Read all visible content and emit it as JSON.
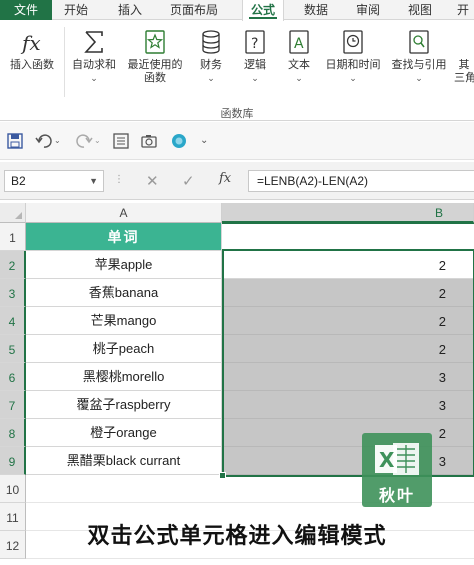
{
  "tabs": [
    {
      "label": "文件"
    },
    {
      "label": "开始"
    },
    {
      "label": "插入"
    },
    {
      "label": "页面布局"
    },
    {
      "label": "公式"
    },
    {
      "label": "数据"
    },
    {
      "label": "审阅"
    },
    {
      "label": "视图"
    },
    {
      "label": "开"
    }
  ],
  "active_tab": "公式",
  "ribbon": {
    "buttons": [
      {
        "label": "插入函数",
        "icon": "fx-icon"
      },
      {
        "label": "自动求和",
        "label2": "",
        "icon": "sigma-icon",
        "dropdown": true
      },
      {
        "label": "最近使用的",
        "label2": "函数",
        "icon": "star-book-icon",
        "dropdown": true
      },
      {
        "label": "财务",
        "icon": "database-icon",
        "dropdown": true
      },
      {
        "label": "逻辑",
        "icon": "question-book-icon",
        "dropdown": true
      },
      {
        "label": "文本",
        "icon": "text-book-icon",
        "dropdown": true
      },
      {
        "label": "日期和时间",
        "icon": "clock-book-icon",
        "dropdown": true
      },
      {
        "label": "查找与引用",
        "icon": "search-book-icon",
        "dropdown": true
      },
      {
        "label": "其",
        "label2": "三角",
        "icon": "more-icon"
      }
    ],
    "group_label": "函数库"
  },
  "quick_access": [
    "save-icon",
    "undo-icon",
    "redo-icon",
    "form-icon",
    "camera-icon",
    "circle-icon",
    "customize-icon"
  ],
  "formula_bar": {
    "name_box": "B2",
    "formula": "=LENB(A2)-LEN(A2)",
    "fx_label": "fx"
  },
  "columns": [
    "A",
    "B"
  ],
  "header_cell": "单词",
  "rows": [
    {
      "num": "1"
    },
    {
      "num": "2",
      "a": "苹果apple",
      "b": "2"
    },
    {
      "num": "3",
      "a": "香蕉banana",
      "b": "2"
    },
    {
      "num": "4",
      "a": "芒果mango",
      "b": "2"
    },
    {
      "num": "5",
      "a": "桃子peach",
      "b": "2"
    },
    {
      "num": "6",
      "a": "黑樱桃morello",
      "b": "3"
    },
    {
      "num": "7",
      "a": "覆盆子raspberry",
      "b": "3"
    },
    {
      "num": "8",
      "a": "橙子orange",
      "b": "2"
    },
    {
      "num": "9",
      "a": "黑醋栗black currant",
      "b": "3"
    },
    {
      "num": "10"
    },
    {
      "num": "11"
    },
    {
      "num": "12"
    }
  ],
  "caption": "双击公式单元格进入编辑模式",
  "logo_text": "秋叶",
  "colors": {
    "accent": "#217346",
    "header_fill": "#3bb492",
    "selection": "#c6c6c6",
    "logo": "#3e915a"
  }
}
